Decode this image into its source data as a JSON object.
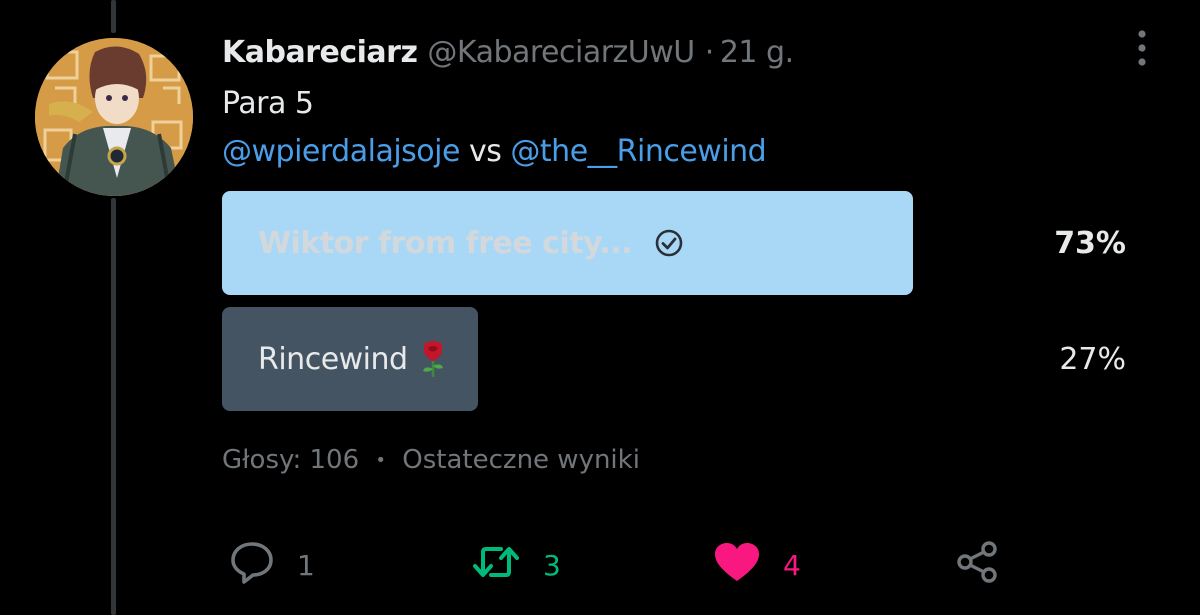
{
  "tweet": {
    "display_name": "Kabareciarz",
    "handle": "@KabareciarzUwU",
    "separator": "·",
    "time": "21 g.",
    "text_line1": "Para 5",
    "mention1": "@wpierdalajsoje",
    "vs": "vs",
    "mention2": "@the__Rincewind"
  },
  "poll": {
    "options": [
      {
        "label": "Wiktor from free city...",
        "percent": "73%",
        "value": 0.73,
        "winner": true,
        "icon": "check-circle-icon"
      },
      {
        "label": "Rincewind",
        "percent": "27%",
        "value": 0.27,
        "winner": false,
        "icon": "rose-icon"
      }
    ],
    "votes": "Głosy: 106",
    "bullet": "•",
    "status": "Ostateczne wyniki"
  },
  "actions": {
    "reply": {
      "count": "1",
      "icon": "reply-icon"
    },
    "retweet": {
      "count": "3",
      "icon": "retweet-icon"
    },
    "like": {
      "count": "4",
      "icon": "heart-icon"
    },
    "share": {
      "icon": "share-icon"
    }
  },
  "colors": {
    "background": "#000000",
    "link": "#4a9ee8",
    "winner_bar": "#a8d8f5",
    "loser_bar": "#455463",
    "retweet": "#00ba7c",
    "like": "#f91880",
    "muted": "#71767b"
  }
}
